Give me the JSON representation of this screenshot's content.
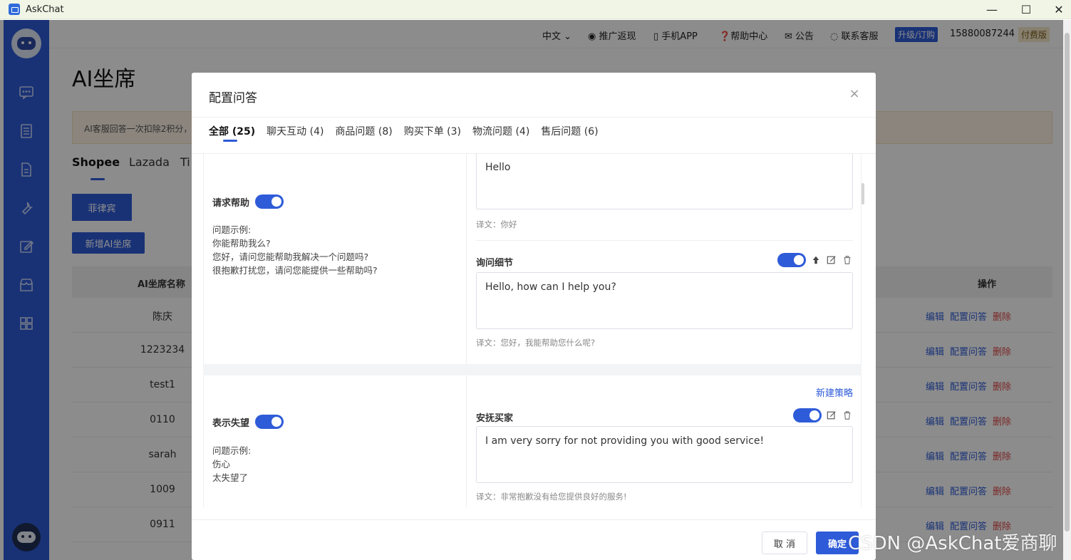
{
  "window": {
    "title": "AskChat",
    "minimize": "—",
    "maximize": "☐",
    "close": "✕"
  },
  "topnav": {
    "lang": "中文",
    "promo": "推广返现",
    "app": "手机APP",
    "help": "帮助中心",
    "notice": "公告",
    "service": "联系客服",
    "upgrade": "升级/订购",
    "phone": "15880087244",
    "plan": "付费版"
  },
  "page": {
    "title": "AI坐席",
    "notice": "AI客服回答一次扣除2积分，",
    "platform_tabs": [
      "Shopee",
      "Lazada",
      "Ti"
    ],
    "region_chip": "菲律宾",
    "add_button": "新增AI坐席",
    "table": {
      "col_name": "AI坐席名称",
      "col_ops": "操作",
      "rows": [
        "陈庆",
        "1223234",
        "test1",
        "0110",
        "sarah",
        "1009",
        "0911"
      ],
      "op_edit": "编辑",
      "op_config": "配置问答",
      "op_delete": "删除"
    }
  },
  "modal": {
    "title": "配置问答",
    "close": "×",
    "tabs": [
      "全部 (25)",
      "聊天互动 (4)",
      "商品问题 (8)",
      "购买下单 (3)",
      "物流问题 (4)",
      "售后问题 (6)"
    ],
    "block1": {
      "intent": "请求帮助",
      "examples_title": "问题示例:",
      "examples": [
        "你能帮助我么?",
        "您好，请问您能帮助我解决一个问题吗?",
        "很抱歉打扰您，请问您能提供一些帮助吗?"
      ],
      "reply1": "Hello",
      "trans1": "译文：你好",
      "strategy2": "询问细节",
      "reply2": "Hello, how can I help you?",
      "trans2": "译文：您好，我能帮助您什么呢?"
    },
    "block2": {
      "intent": "表示失望",
      "examples_title": "问题示例:",
      "examples": [
        "伤心",
        "太失望了"
      ],
      "new_strategy": "新建策略",
      "strategy": "安抚买家",
      "reply": "I am very sorry for not providing you with good service!",
      "trans": "译文：非常抱歉没有给您提供良好的服务!"
    },
    "cancel": "取 消",
    "confirm": "确定"
  },
  "watermark": "CSDN @AskChat爱商聊",
  "colors": {
    "primary": "#2e5bd8",
    "danger": "#e04848",
    "sidebar": "#2e5bd8"
  }
}
